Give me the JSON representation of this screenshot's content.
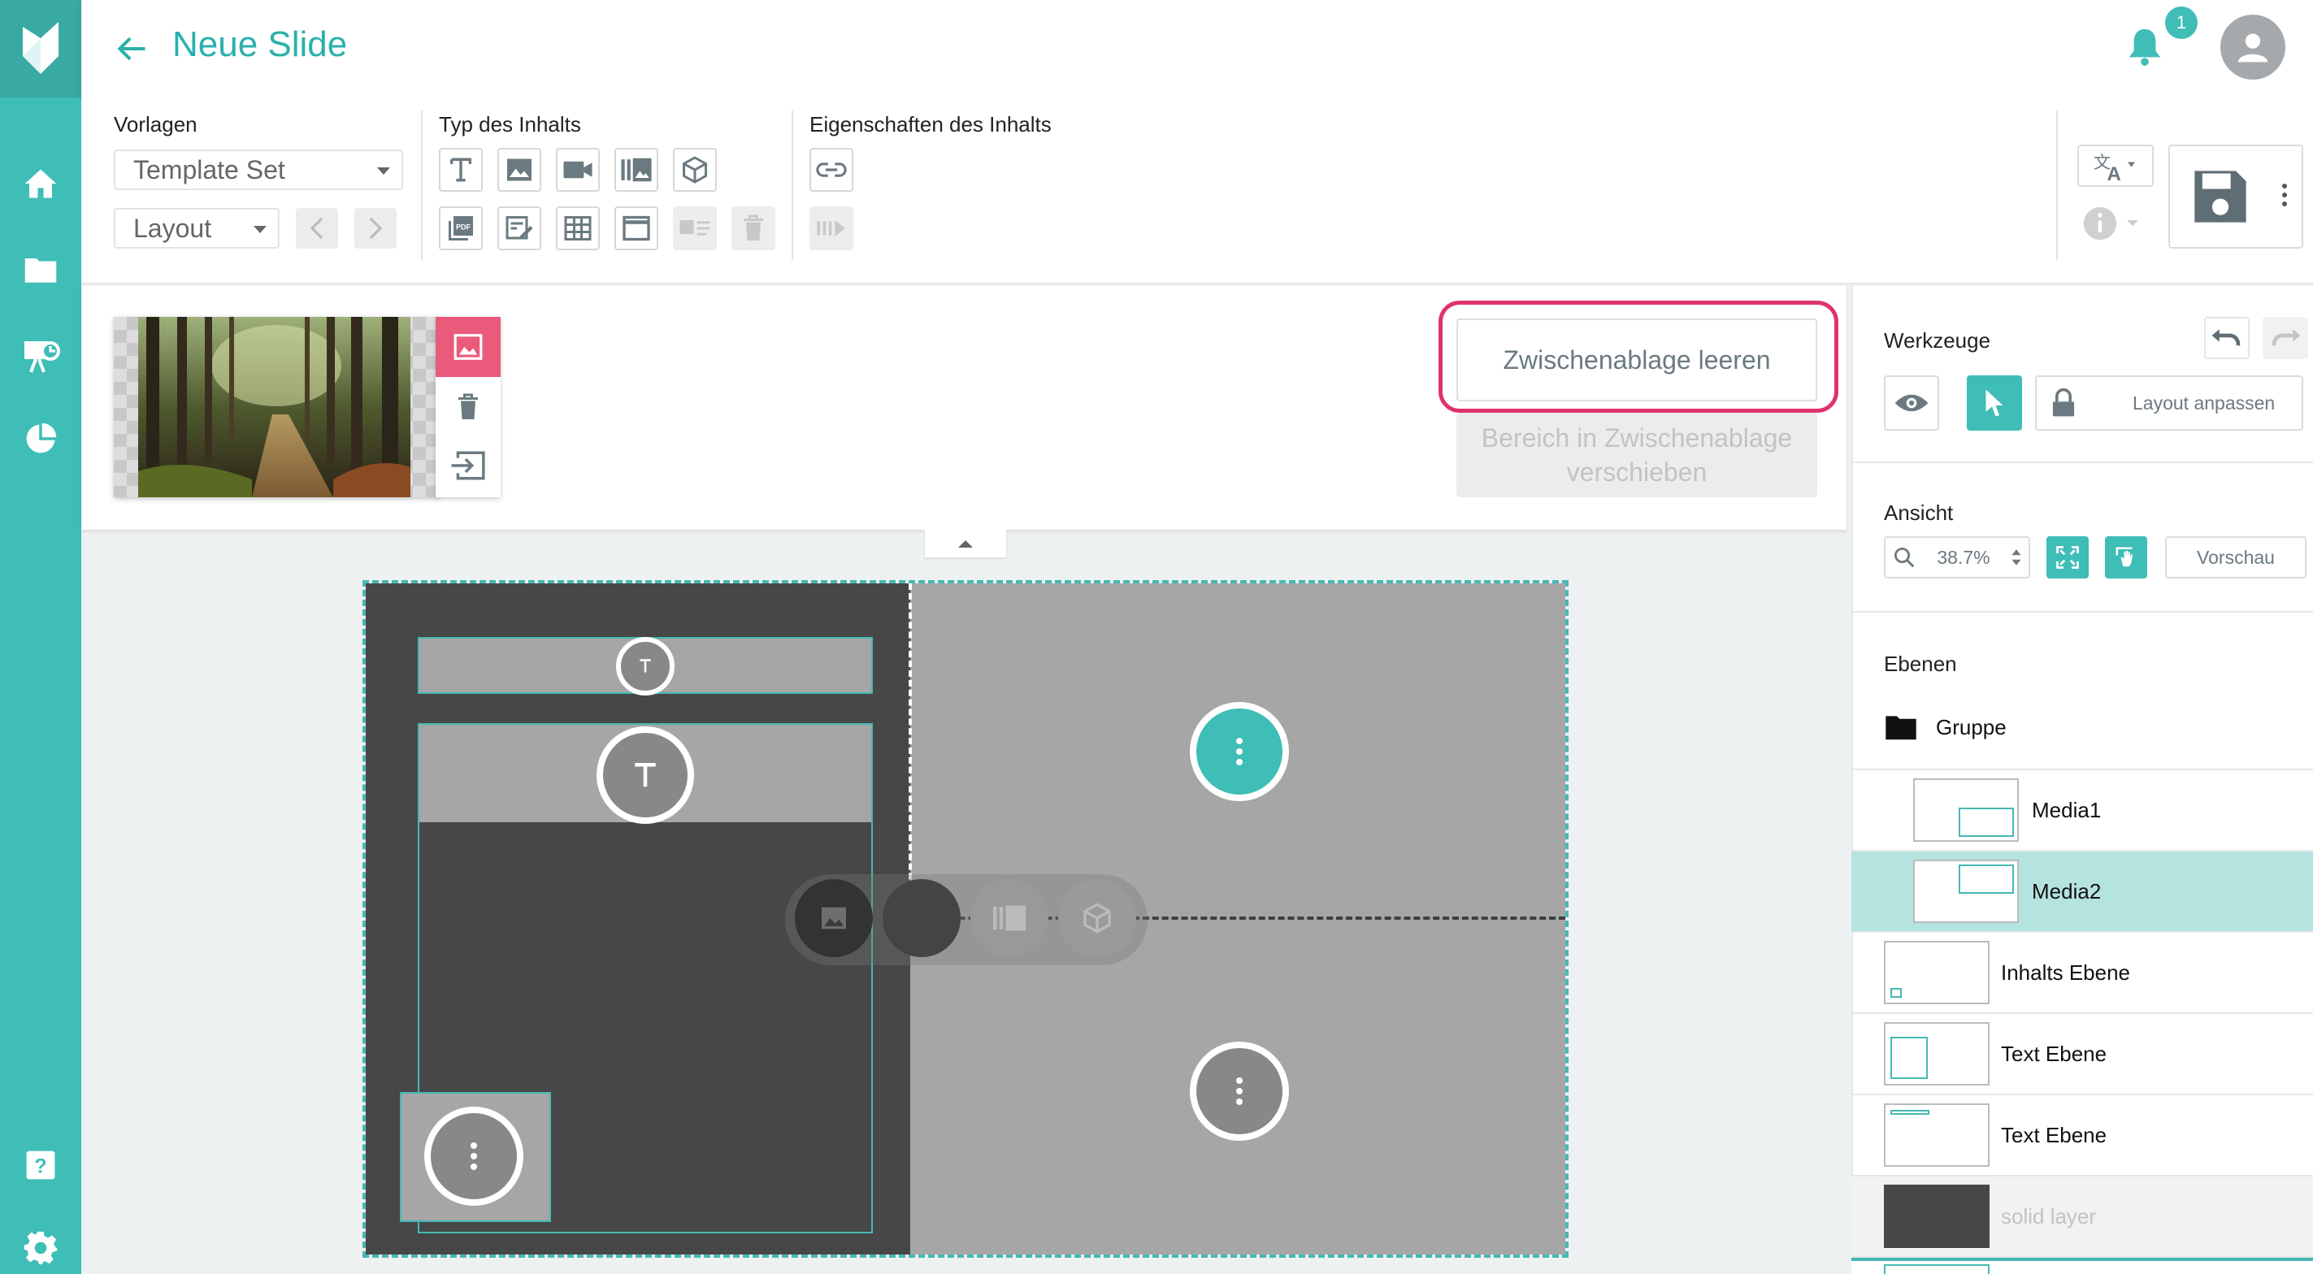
{
  "app": {
    "title": "Neue Slide",
    "notifications_count": "1"
  },
  "toolbar": {
    "vorlagen": {
      "label": "Vorlagen",
      "template_select": "Template Set",
      "layout_select": "Layout"
    },
    "content_type": {
      "label": "Typ des Inhalts",
      "row1_icons": [
        "text-icon",
        "image-icon",
        "video-icon",
        "gallery-icon",
        "3d-cube-icon"
      ],
      "row2_icons": [
        "pdf-icon",
        "form-icon",
        "table-icon",
        "window-icon",
        "card-icon",
        "trash-icon"
      ]
    },
    "properties": {
      "label": "Eigenschaften des Inhalts"
    }
  },
  "clipboard": {
    "clear_label": "Zwischenablage leeren",
    "move_label_line1": "Bereich in Zwischenablage",
    "move_label_line2": "verschieben"
  },
  "sidebar": {
    "tools": {
      "title": "Werkzeuge",
      "layout_button": "Layout anpassen"
    },
    "view": {
      "title": "Ansicht",
      "zoom": "38.7%",
      "preview_button": "Vorschau"
    },
    "layers": {
      "title": "Ebenen",
      "group_name": "Gruppe",
      "items": [
        {
          "name": "Media1"
        },
        {
          "name": "Media2"
        },
        {
          "name": "Inhalts Ebene"
        },
        {
          "name": "Text Ebene"
        },
        {
          "name": "Text Ebene"
        },
        {
          "name": "solid layer"
        }
      ]
    }
  },
  "colors": {
    "accent": "#3fbdb7",
    "highlight": "#e0336e",
    "image_button": "#ea5b7b"
  }
}
